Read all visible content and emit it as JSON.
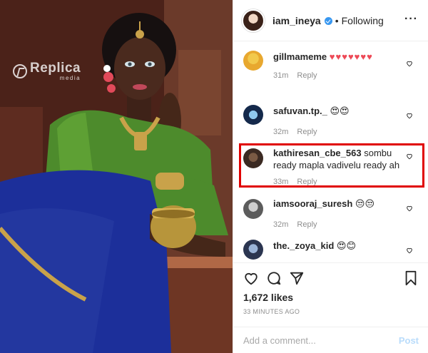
{
  "watermark": {
    "main": "Replica",
    "sub": "media"
  },
  "post": {
    "username": "iam_ineya",
    "separator": "•",
    "follow_status": "Following",
    "more_icon": "more-horizontal-icon",
    "verified_color": "#3897f0"
  },
  "comments": [
    {
      "username": "gillmameme",
      "text": "",
      "emoji": "♥♥♥♥♥♥♥",
      "emoji_color": "#ed4956",
      "time": "31m",
      "reply": "Reply"
    },
    {
      "username": "safuvan.tp._",
      "text": "",
      "emoji": "😍😍",
      "time": "32m",
      "reply": "Reply"
    },
    {
      "username": "kathiresan_cbe_563",
      "text": "sombu ready mapla vadivelu ready ah",
      "emoji": "",
      "time": "33m",
      "reply": "Reply",
      "highlighted": true
    },
    {
      "username": "iamsooraj_suresh",
      "text": "",
      "emoji": "😒😒",
      "time": "32m",
      "reply": "Reply"
    },
    {
      "username": "the._zoya_kid",
      "text": "",
      "emoji": "😍😊",
      "time": "",
      "reply": ""
    }
  ],
  "highlight_color": "#e00000",
  "actions": {
    "icons": [
      "heart-icon",
      "comment-icon",
      "share-icon",
      "bookmark-icon"
    ],
    "likes": "1,672 likes",
    "time_ago": "33 MINUTES AGO"
  },
  "add_comment": {
    "placeholder": "Add a comment...",
    "post_label": "Post",
    "post_color": "#b9dcfb"
  }
}
